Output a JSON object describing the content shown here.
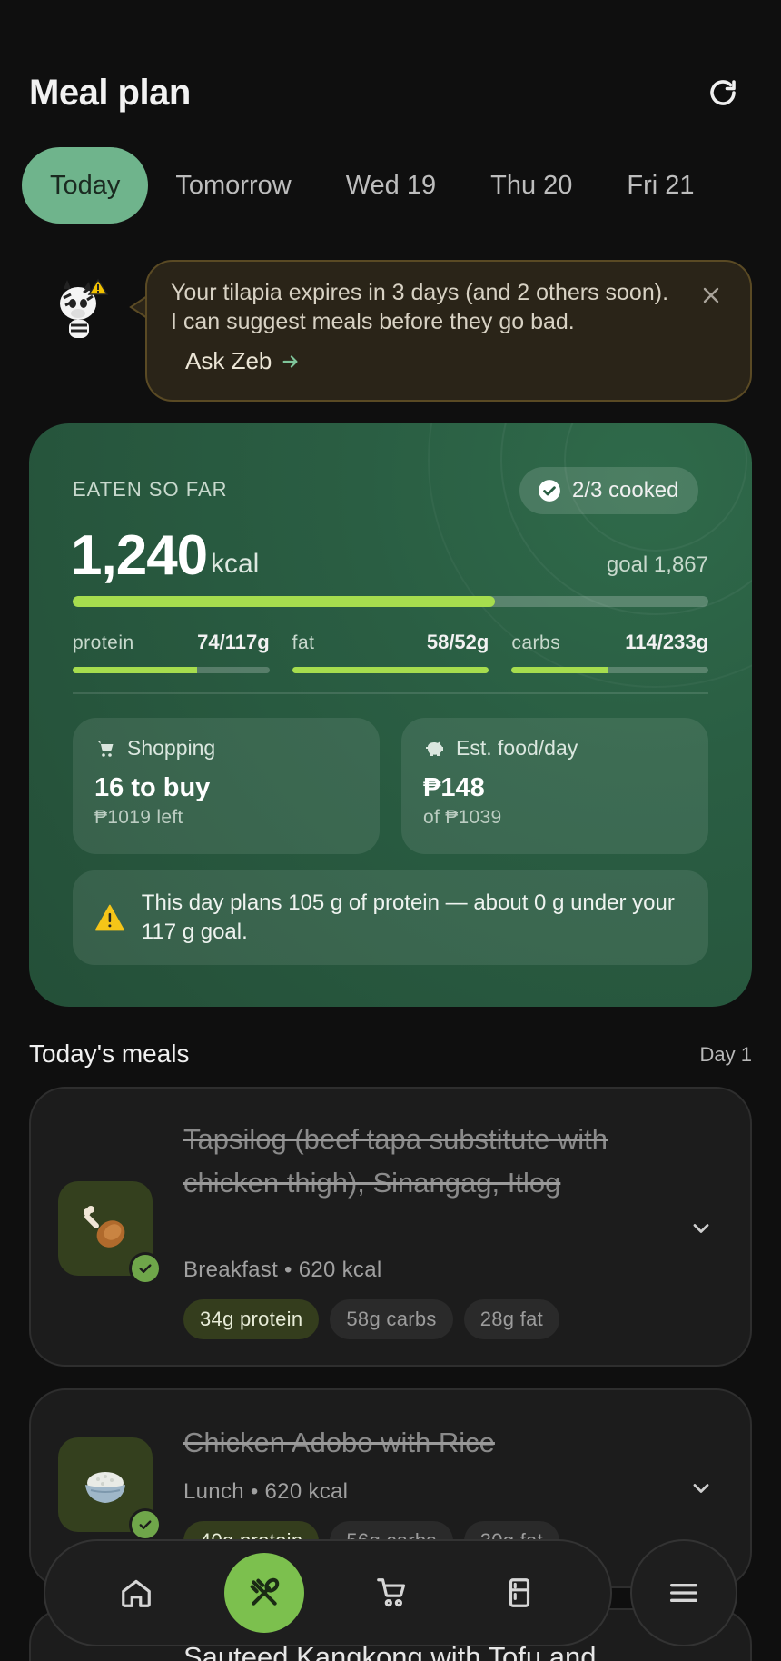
{
  "header": {
    "title": "Meal plan",
    "refresh_icon": "refresh-icon"
  },
  "tabs": [
    {
      "label": "Today",
      "active": true
    },
    {
      "label": "Tomorrow",
      "active": false
    },
    {
      "label": "Wed 19",
      "active": false
    },
    {
      "label": "Thu 20",
      "active": false
    },
    {
      "label": "Fri 21",
      "active": false
    }
  ],
  "banner": {
    "text": "Your tilapia expires in 3 days (and 2 others soon). I can suggest meals before they go bad.",
    "action_label": "Ask Zeb",
    "border_color": "#5a4a24",
    "background": "#2a2418"
  },
  "summary": {
    "eaten_label": "EATEN SO FAR",
    "cooked": "2/3 cooked",
    "kcal": "1,240",
    "kcal_unit": "kcal",
    "goal": "goal 1,867",
    "kcal_progress": 0.664,
    "macros": [
      {
        "name": "protein",
        "value": "74/117g",
        "progress": 0.63
      },
      {
        "name": "fat",
        "value": "58/52g",
        "progress": 1.0
      },
      {
        "name": "carbs",
        "value": "114/233g",
        "progress": 0.49
      }
    ],
    "shopping": {
      "label": "Shopping",
      "main": "16 to buy",
      "sub": "₱1019 left"
    },
    "food_day": {
      "label": "Est. food/day",
      "main": "₱148",
      "sub": "of ₱1039"
    },
    "warning": "This day plans 105 g of protein — about 0 g under your 117 g goal.",
    "accent": "#a6dd4e"
  },
  "meals": {
    "heading": "Today's meals",
    "day_label": "Day 1",
    "items": [
      {
        "name": "Tapsilog (beef tapa substitute with chicken thigh), Sinangag, Itlog",
        "meta": "Breakfast • 620 kcal",
        "protein": "34g protein",
        "carbs": "58g carbs",
        "fat": "28g fat",
        "icon": "chicken-leg-icon",
        "cooked": true
      },
      {
        "name": "Chicken Adobo with Rice",
        "meta": "Lunch • 620 kcal",
        "protein": "40g protein",
        "carbs": "56g carbs",
        "fat": "30g fat",
        "icon": "rice-bowl-icon",
        "cooked": true
      },
      {
        "name": "Sauteed Kangkong with Tofu and",
        "cooked": false
      }
    ]
  },
  "nav": {
    "items": [
      "home-icon",
      "utensils-icon",
      "cart-icon",
      "fridge-icon"
    ],
    "active": "utensils-icon",
    "menu": "menu-icon",
    "active_color": "#7cc04e"
  }
}
